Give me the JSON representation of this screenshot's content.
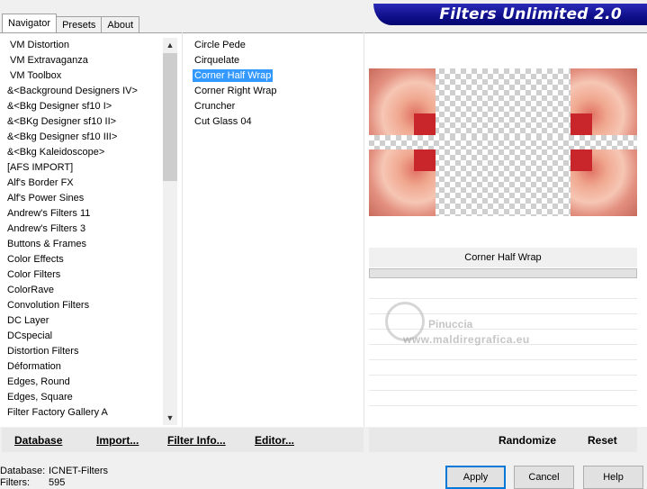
{
  "tabs": [
    "Navigator",
    "Presets",
    "About"
  ],
  "banner_title": "Filters Unlimited 2.0",
  "categories": [
    "VM Distortion",
    "VM Extravaganza",
    "VM Toolbox",
    "&<Background Designers IV>",
    "&<Bkg Designer sf10 I>",
    "&<BKg Designer sf10 II>",
    "&<Bkg Designer sf10 III>",
    "&<Bkg Kaleidoscope>",
    "[AFS IMPORT]",
    "Alf's Border FX",
    "Alf's Power Sines",
    "Andrew's Filters 11",
    "Andrew's Filters 3",
    "Buttons & Frames",
    "Color Effects",
    "Color Filters",
    "ColorRave",
    "Convolution Filters",
    "DC Layer",
    "DCspecial",
    "Distortion Filters",
    "Déformation",
    "Edges, Round",
    "Edges, Square",
    "Filter Factory Gallery A"
  ],
  "filters": [
    "Circle Pede",
    "Cirquelate",
    "Corner Half Wrap",
    "Corner Right Wrap",
    "Cruncher",
    "Cut Glass 04"
  ],
  "selected_filter": "Corner Half Wrap",
  "filter_name_label": "Corner Half Wrap",
  "watermark": {
    "name": "Pinuccia",
    "site": "www.maldiregrafica.eu"
  },
  "toolbar": {
    "database_label": "Database",
    "import_label": "Import...",
    "filter_info_label": "Filter Info...",
    "editor_label": "Editor...",
    "randomize_label": "Randomize",
    "reset_label": "Reset"
  },
  "status": {
    "database_key": "Database:",
    "database_value": "ICNET-Filters",
    "filters_key": "Filters:",
    "filters_value": "595"
  },
  "buttons": {
    "apply": "Apply",
    "cancel": "Cancel",
    "help": "Help"
  },
  "colors": {
    "banner": "#0f0f8a",
    "selection": "#3399ff",
    "tile_red": "#c8262a"
  }
}
